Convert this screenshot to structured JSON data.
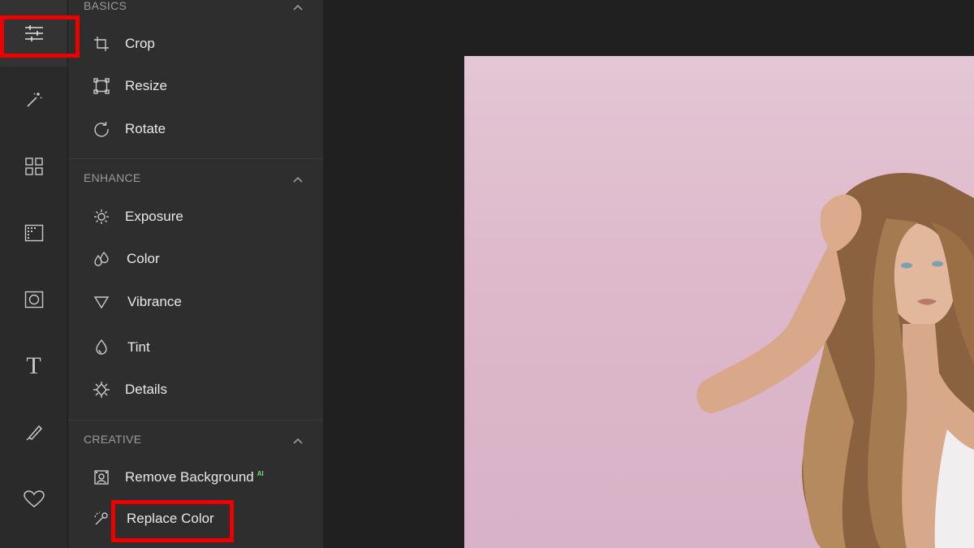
{
  "rail": {
    "items": [
      {
        "name": "adjust-icon",
        "active": true
      },
      {
        "name": "magic-wand-icon"
      },
      {
        "name": "grid-icon"
      },
      {
        "name": "texture-icon"
      },
      {
        "name": "frame-icon"
      },
      {
        "name": "text-icon",
        "glyph": "T"
      },
      {
        "name": "draw-icon"
      },
      {
        "name": "heart-icon"
      }
    ]
  },
  "panel": {
    "sections": {
      "basics": {
        "title": "BASICS",
        "tools": {
          "crop": "Crop",
          "resize": "Resize",
          "rotate": "Rotate"
        }
      },
      "enhance": {
        "title": "ENHANCE",
        "tools": {
          "exposure": "Exposure",
          "color": "Color",
          "vibrance": "Vibrance",
          "tint": "Tint",
          "details": "Details"
        }
      },
      "creative": {
        "title": "CREATIVE",
        "tools": {
          "remove_background": "Remove Background",
          "remove_background_badge": "AI",
          "replace_color": "Replace Color"
        }
      }
    }
  },
  "colors": {
    "highlight": "#ee0000",
    "icon": "#c8c8c8",
    "ai_badge": "#6ee07a"
  }
}
